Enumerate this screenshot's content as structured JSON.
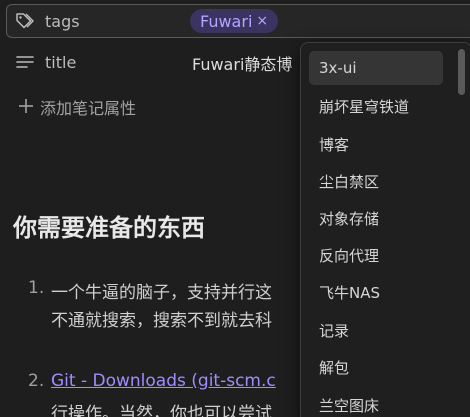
{
  "properties": {
    "tags": {
      "key": "tags",
      "icon": "tags-icon",
      "chips": [
        {
          "label": "Fuwari",
          "remove": "×"
        }
      ]
    },
    "title": {
      "key": "title",
      "icon": "text-lines-icon",
      "value": "Fuwari静态博"
    },
    "add_label": "添加笔记属性"
  },
  "content": {
    "heading": "你需要准备的东西",
    "list": [
      {
        "num": "1.",
        "text": "一个牛逼的脑子，支持并行这"
      },
      {
        "num": "",
        "text": "不通就搜索，搜索不到就去科"
      },
      {
        "num": "2.",
        "link": "Git - Downloads (git-scm.c"
      },
      {
        "num": "",
        "text": "行操作。当然，你也可以尝试"
      }
    ]
  },
  "dropdown": {
    "items": [
      "3x-ui",
      "崩坏星穹铁道",
      "博客",
      "尘白禁区",
      "对象存储",
      "反向代理",
      "飞牛NAS",
      "记录",
      "解包",
      "兰空图床"
    ],
    "selected_index": 0
  },
  "colors": {
    "background": "#1e1e1e",
    "chip_bg": "#3b3360",
    "chip_text": "#b4a5ff",
    "link": "#a28bff"
  }
}
